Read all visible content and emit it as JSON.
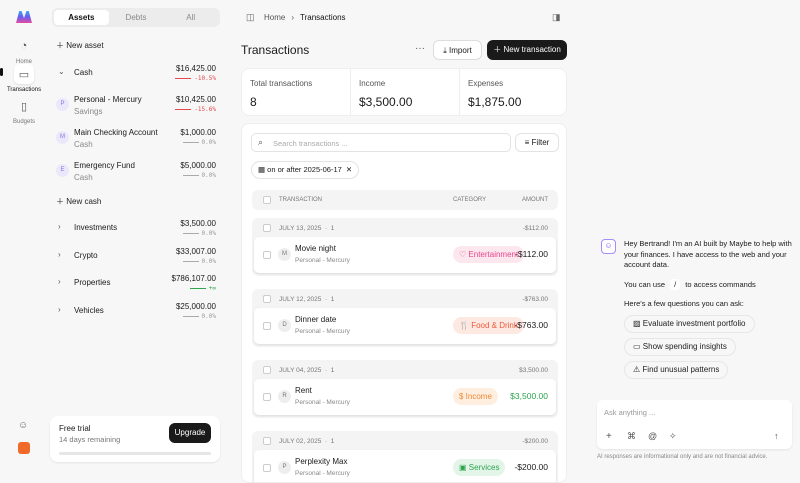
{
  "nav": {
    "items": [
      {
        "label": "Home",
        "icon": "pie-chart-icon"
      },
      {
        "label": "Transactions",
        "icon": "credit-card-icon"
      },
      {
        "label": "Budgets",
        "icon": "map-icon"
      }
    ]
  },
  "sidebar": {
    "tabs": [
      "Assets",
      "Debts",
      "All"
    ],
    "new_asset": "New asset",
    "cash": {
      "name": "Cash",
      "amount": "$16,425.00",
      "change": "-10.5%"
    },
    "accounts": [
      {
        "initial": "P",
        "name": "Personal - Mercury",
        "type": "Savings",
        "amount": "$10,425.00",
        "change": "-15.6%"
      },
      {
        "initial": "M",
        "name": "Main Checking Account",
        "type": "Cash",
        "amount": "$1,000.00",
        "change": "0.0%"
      },
      {
        "initial": "E",
        "name": "Emergency Fund",
        "type": "Cash",
        "amount": "$5,000.00",
        "change": "0.0%"
      }
    ],
    "new_cash": "New cash",
    "groups": [
      {
        "name": "Investments",
        "amount": "$3,500.00",
        "change": "0.0%"
      },
      {
        "name": "Crypto",
        "amount": "$33,007.00",
        "change": "0.0%"
      },
      {
        "name": "Properties",
        "amount": "$786,107.00",
        "change": "+∞"
      },
      {
        "name": "Vehicles",
        "amount": "$25,000.00",
        "change": "0.0%"
      }
    ],
    "trial": {
      "title": "Free trial",
      "sub": "14 days remaining",
      "button": "Upgrade",
      "progress": 0.0
    }
  },
  "breadcrumb": [
    "Home",
    "Transactions"
  ],
  "main": {
    "title": "Transactions",
    "import": "Import",
    "new": "New transaction",
    "stats": [
      {
        "label": "Total transactions",
        "value": "8"
      },
      {
        "label": "Income",
        "value": "$3,500.00"
      },
      {
        "label": "Expenses",
        "value": "$1,875.00"
      }
    ],
    "search_placeholder": "Search transactions ...",
    "filter": "Filter",
    "chip": "on or after 2025-06-17",
    "headers": {
      "transaction": "TRANSACTION",
      "category": "CATEGORY",
      "amount": "AMOUNT"
    },
    "groups": [
      {
        "date": "JULY 13, 2025",
        "count": "1",
        "total": "-$112.00",
        "tx": {
          "initial": "M",
          "name": "Movie night",
          "account": "Personal - Mercury",
          "category": "Entertainment",
          "amount": "-$112.00"
        }
      },
      {
        "date": "JULY 12, 2025",
        "count": "1",
        "total": "-$763.00",
        "tx": {
          "initial": "D",
          "name": "Dinner date",
          "account": "Personal - Mercury",
          "category": "Food & Drink",
          "amount": "-$763.00"
        }
      },
      {
        "date": "JULY 04, 2025",
        "count": "1",
        "total": "$3,500.00",
        "tx": {
          "initial": "R",
          "name": "Rent",
          "account": "Personal - Mercury",
          "category": "Income",
          "amount": "$3,500.00"
        }
      },
      {
        "date": "JULY 02, 2025",
        "count": "1",
        "total": "-$200.00",
        "tx": {
          "initial": "P",
          "name": "Perplexity Max",
          "account": "Personal - Mercury",
          "category": "Services",
          "amount": "-$200.00"
        }
      }
    ]
  },
  "chat": {
    "greeting": "Hey Bertrand! I'm an AI built by Maybe to help with your finances. I have access to the web and your account data.",
    "cmd_pre": "You can use",
    "cmd_key": "/",
    "cmd_post": "to access commands",
    "questions_intro": "Here's a few questions you can ask:",
    "suggestions": [
      "Evaluate investment portfolio",
      "Show spending insights",
      "Find unusual patterns"
    ],
    "placeholder": "Ask anything ...",
    "disclaimer": "AI responses are informational only and are not financial advice."
  },
  "colors": {
    "negative": "#e5484d",
    "positive": "#2da44e",
    "primary": "#1a1a1a"
  }
}
